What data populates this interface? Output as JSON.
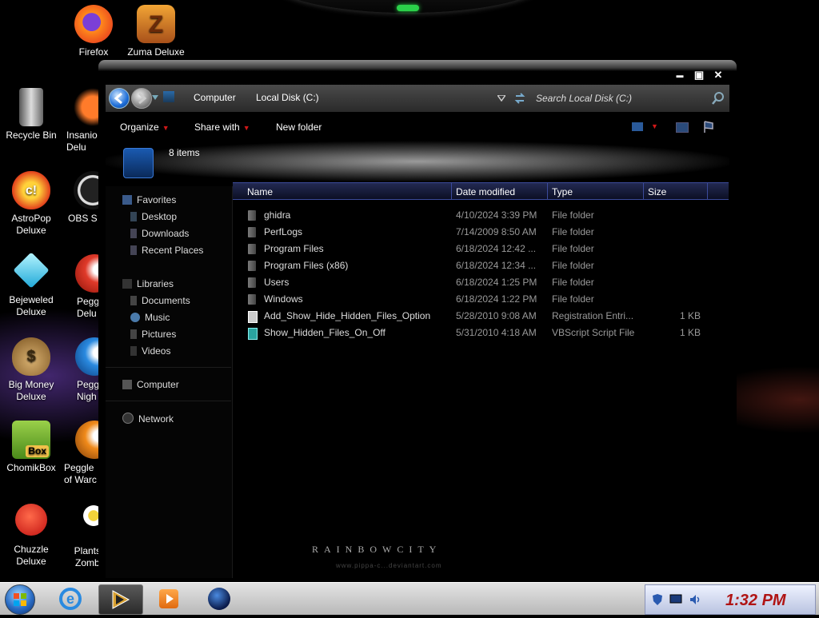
{
  "desktop": {
    "icons": [
      {
        "label": "Firefox"
      },
      {
        "label": "Zuma Deluxe"
      },
      {
        "label": "Recycle Bin"
      },
      {
        "label": "Insanio\nDelu"
      },
      {
        "label": "AstroPop\nDeluxe"
      },
      {
        "label": "OBS S"
      },
      {
        "label": "Bejeweled\nDeluxe"
      },
      {
        "label": "Pegg\nDelu"
      },
      {
        "label": "Big Money\nDeluxe"
      },
      {
        "label": "Pegg\nNigh"
      },
      {
        "label": "ChomikBox"
      },
      {
        "label": "Peggle\nof Warc"
      },
      {
        "label": "Chuzzle\nDeluxe"
      },
      {
        "label": "Plants vs\nZombies"
      }
    ],
    "chomik_badge": "Box",
    "astropop_badge": "c!",
    "watermark": "RAINBOWCITY",
    "watermark_sub": "www.pippa-c...deviantart.com"
  },
  "window": {
    "controls": {
      "minimize": "▬",
      "maximize": "▣",
      "close": "✕"
    },
    "breadcrumb": [
      "Computer",
      "Local Disk (C:)"
    ],
    "search_placeholder": "Search Local Disk (C:)",
    "toolbar": {
      "organize": "Organize",
      "share_with": "Share with",
      "new_folder": "New folder"
    },
    "item_count": "8 items",
    "nav": {
      "favorites": "Favorites",
      "desktop": "Desktop",
      "downloads": "Downloads",
      "recent_places": "Recent Places",
      "libraries": "Libraries",
      "documents": "Documents",
      "music": "Music",
      "pictures": "Pictures",
      "videos": "Videos",
      "computer": "Computer",
      "network": "Network"
    },
    "columns": {
      "name": "Name",
      "date": "Date modified",
      "type": "Type",
      "size": "Size"
    },
    "files": [
      {
        "name": "ghidra",
        "date": "4/10/2024 3:39 PM",
        "type": "File folder",
        "size": "",
        "icon": "folder-icon"
      },
      {
        "name": "PerfLogs",
        "date": "7/14/2009 8:50 AM",
        "type": "File folder",
        "size": "",
        "icon": "folder-icon"
      },
      {
        "name": "Program Files",
        "date": "6/18/2024 12:42 ...",
        "type": "File folder",
        "size": "",
        "icon": "folder-icon"
      },
      {
        "name": "Program Files (x86)",
        "date": "6/18/2024 12:34 ...",
        "type": "File folder",
        "size": "",
        "icon": "folder-icon"
      },
      {
        "name": "Users",
        "date": "6/18/2024 1:25 PM",
        "type": "File folder",
        "size": "",
        "icon": "folder-icon"
      },
      {
        "name": "Windows",
        "date": "6/18/2024 1:22 PM",
        "type": "File folder",
        "size": "",
        "icon": "folder-icon"
      },
      {
        "name": "Add_Show_Hide_Hidden_Files_Option",
        "date": "5/28/2010 9:08 AM",
        "type": "Registration Entri...",
        "size": "1 KB",
        "icon": "reg-icon"
      },
      {
        "name": "Show_Hidden_Files_On_Off",
        "date": "5/31/2010 4:18 AM",
        "type": "VBScript Script File",
        "size": "1 KB",
        "icon": "vbs-icon"
      }
    ]
  },
  "taskbar": {
    "clock": "1:32 PM",
    "accent_color": "#b01414"
  }
}
